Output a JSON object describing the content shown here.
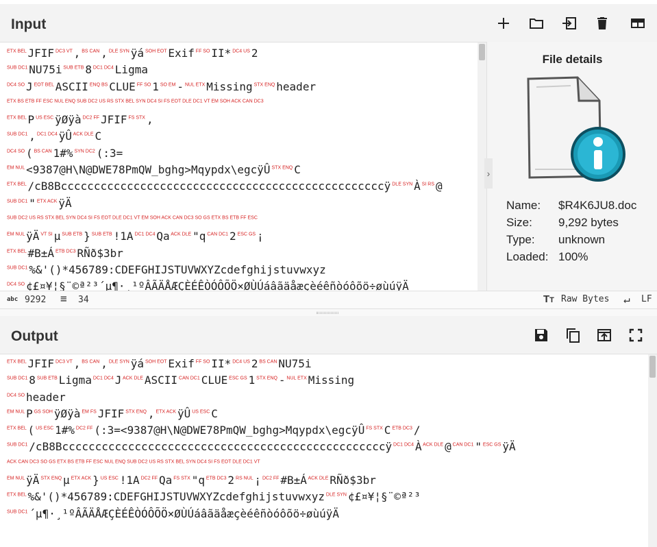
{
  "input": {
    "title": "Input",
    "lines": [
      "JFIF , , ÿá Exif II* 2",
      "NU75i 8 Ligma",
      "J ASCII CLUE 1 - Missing header",
      "",
      "P ÿØÿà JFIF ,",
      ", ÿÛ C",
      "( 1#% (:3=",
      "<9387@H\\N@DWE78PmQW_bghg>Mqypdx\\egcÿÛ C",
      "/cB8Bcccccccccccccccccccccccccccccccccccccccccccccccccÿ À @",
      "\" ÿÄ",
      "",
      "ÿÄ µ } !1A Qa \"q 2 ¡",
      "#B±Á RÑð$3br",
      "%&'()*456789:CDEFGHIJSTUVWXYZcdefghijstuvwxyz",
      "¢£¤¥¦§¨©ª²³´µ¶·¸¹ºÂÃÄÅÆÇÈÉÊÒÓÔÕÖ×ØÙÚáâãäåæçèéêñòóôõö÷øùúÿÄ"
    ],
    "status": {
      "chars": "9292",
      "lines": "34",
      "format": "Raw Bytes",
      "eol": "LF"
    }
  },
  "file_details": {
    "title": "File details",
    "name_label": "Name:",
    "name_value": "$R4K6JU8.doc",
    "size_label": "Size:",
    "size_value": "9,292 bytes",
    "type_label": "Type:",
    "type_value": "unknown",
    "loaded_label": "Loaded:",
    "loaded_value": "100%"
  },
  "output": {
    "title": "Output",
    "lines": [
      "JFIF , , ÿá Exif II* 2 NU75i",
      "8 Ligma J ASCII CLUE 1 - Missing",
      "header",
      "P ÿØÿà JFIF , ÿÛ C",
      "( 1#% (:3=<9387@H\\N@DWE78PmQW_bghg>Mqypdx\\egcÿÛ C /",
      "/cB8Bcccccccccccccccccccccccccccccccccccccccccccccccccÿ À @ \" ÿÄ",
      "",
      "ÿÄ µ } !1A Qa \"q 2 ¡ #B±Á RÑð$3br",
      "%&'()*456789:CDEFGHIJSTUVWXYZcdefghijstuvwxyz ¢£¤¥¦§¨©ª²³",
      "´µ¶·¸¹ºÂÃÄÅÆÇÈÉÊÒÓÔÕÖ×ØÙÚáâãäåæçèéêñòóôõö÷øùúÿÄ"
    ]
  }
}
